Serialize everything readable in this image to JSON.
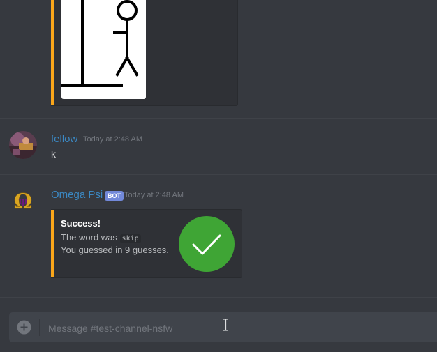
{
  "messages": [
    {
      "username": "fellow",
      "timestamp": "Today at 2:48 AM",
      "content": "k"
    },
    {
      "username": "Omega Psi",
      "badge": "BOT",
      "timestamp": "Today at 2:48 AM",
      "embed": {
        "title": "Success!",
        "line1_prefix": "The word was",
        "word": "skip",
        "line2": "You guessed in 9 guesses.",
        "accent_color": "#faa61a",
        "thumbnail_icon": "checkmark-icon"
      }
    }
  ],
  "composer": {
    "placeholder": "Message #test-channel-nsfw"
  },
  "colors": {
    "background": "#36393f",
    "username": "#3b88c3",
    "bot_badge": "#7289da",
    "embed_accent": "#faa61a",
    "success_green": "#3fa535"
  }
}
